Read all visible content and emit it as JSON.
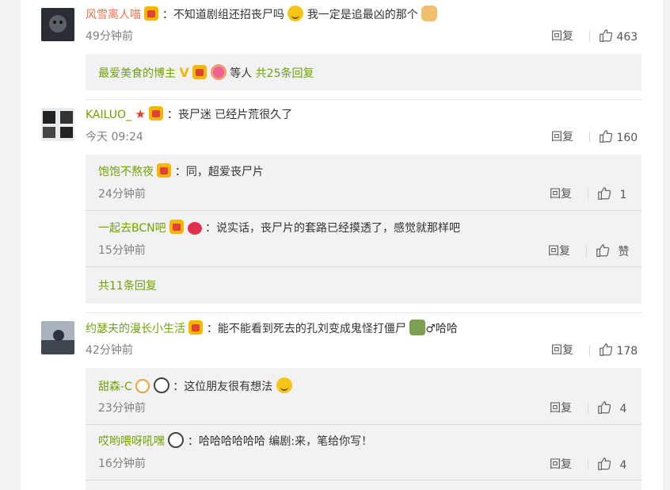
{
  "ui": {
    "reply": "回复",
    "colon": "：",
    "like_zan": "赞"
  },
  "comments": [
    {
      "name": "风雪离人喵",
      "text_a": "不知道剧组还招丧尸吗",
      "text_b": "我一定是追最凶的那个",
      "time": "49分钟前",
      "likes": "463",
      "more": {
        "name": "最爱美食的博主",
        "suffix": "等人",
        "count": "共25条回复"
      }
    },
    {
      "name": "KAILUO_",
      "text": "丧尸迷 已经片荒很久了",
      "time": "今天 09:24",
      "likes": "160",
      "replies": [
        {
          "name": "饱饱不熬夜",
          "text": "同，超爱丧尸片",
          "time": "24分钟前",
          "likes": "1"
        },
        {
          "name": "一起去BCN吧",
          "text": "说实话，丧尸片的套路已经摸透了，感觉就那样吧",
          "time": "15分钟前",
          "likes": "赞"
        }
      ],
      "more": "共11条回复"
    },
    {
      "name": "约瑟夫的漫长小生活",
      "text_a": "能不能看到死去的孔刘变成鬼怪打僵尸",
      "text_b": "♂哈哈",
      "time": "42分钟前",
      "likes": "178",
      "replies": [
        {
          "name": "甜森-C",
          "text": "这位朋友很有想法",
          "time": "23分钟前",
          "likes": "4"
        },
        {
          "name": "哎哟喂呀吼嘿",
          "text": "哈哈哈哈哈哈 编剧:来，笔给你写！",
          "time": "16分钟前",
          "likes": "4"
        }
      ]
    }
  ]
}
